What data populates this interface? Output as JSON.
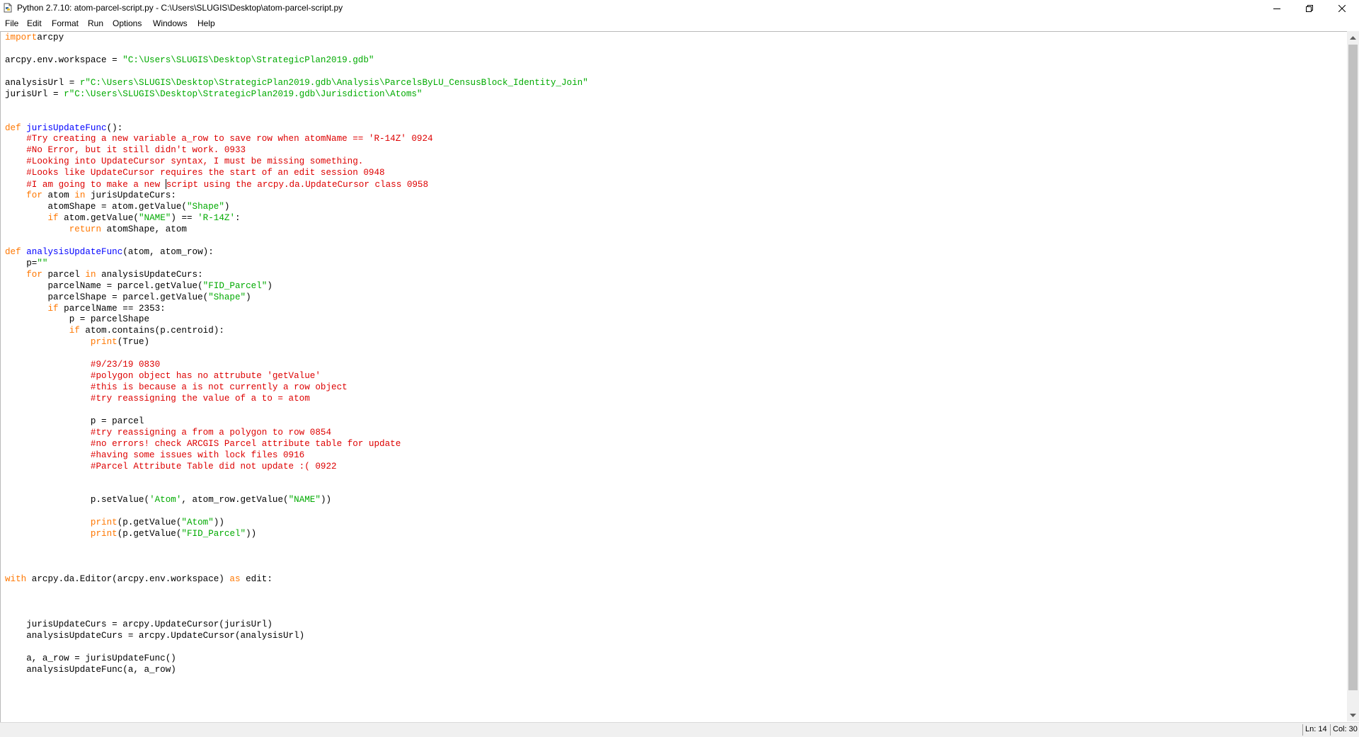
{
  "window": {
    "title": "Python 2.7.10: atom-parcel-script.py - C:\\Users\\SLUGIS\\Desktop\\atom-parcel-script.py"
  },
  "menu": [
    "File",
    "Edit",
    "Format",
    "Run",
    "Options",
    "Windows",
    "Help"
  ],
  "status": {
    "line": "Ln: 14",
    "col": "Col: 30"
  },
  "colors": {
    "keyword": "#ff7700",
    "builtin_def": "#0000ff",
    "string": "#00aa00",
    "comment": "#dd0000"
  },
  "code": [
    [
      [
        "kw",
        "import"
      ],
      [
        "",
        "arcpy"
      ]
    ],
    [],
    [
      [
        "",
        "arcpy.env.workspace = "
      ],
      [
        "str",
        "\"C:\\Users\\SLUGIS\\Desktop\\StrategicPlan2019.gdb\""
      ]
    ],
    [],
    [
      [
        "",
        "analysisUrl = "
      ],
      [
        "str",
        "r\"C:\\Users\\SLUGIS\\Desktop\\StrategicPlan2019.gdb\\Analysis\\ParcelsByLU_CensusBlock_Identity_Join\""
      ]
    ],
    [
      [
        "",
        "jurisUrl = "
      ],
      [
        "str",
        "r\"C:\\Users\\SLUGIS\\Desktop\\StrategicPlan2019.gdb\\Jurisdiction\\Atoms\""
      ]
    ],
    [],
    [],
    [
      [
        "kw",
        "def "
      ],
      [
        "fn",
        "jurisUpdateFunc"
      ],
      [
        "",
        "():"
      ]
    ],
    [
      [
        "",
        "    "
      ],
      [
        "cm",
        "#Try creating a new variable a_row to save row when atomName == 'R-14Z' 0924"
      ]
    ],
    [
      [
        "",
        "    "
      ],
      [
        "cm",
        "#No Error, but it still didn't work. 0933"
      ]
    ],
    [
      [
        "",
        "    "
      ],
      [
        "cm",
        "#Looking into UpdateCursor syntax, I must be missing something."
      ]
    ],
    [
      [
        "",
        "    "
      ],
      [
        "cm",
        "#Looks like UpdateCursor requires the start of an edit session 0948"
      ]
    ],
    [
      [
        "",
        "    "
      ],
      [
        "cm",
        "#I am going to make a new "
      ],
      [
        "caret",
        ""
      ],
      [
        "cm",
        "script using the arcpy.da.UpdateCursor class 0958"
      ]
    ],
    [
      [
        "",
        "    "
      ],
      [
        "kw",
        "for"
      ],
      [
        "",
        " atom "
      ],
      [
        "kw",
        "in"
      ],
      [
        "",
        " jurisUpdateCurs:"
      ]
    ],
    [
      [
        "",
        "        atomShape = atom.getValue("
      ],
      [
        "str",
        "\"Shape\""
      ],
      [
        "",
        ")"
      ]
    ],
    [
      [
        "",
        "        "
      ],
      [
        "kw",
        "if"
      ],
      [
        "",
        " atom.getValue("
      ],
      [
        "str",
        "\"NAME\""
      ],
      [
        "",
        ") == "
      ],
      [
        "str",
        "'R-14Z'"
      ],
      [
        "",
        ":"
      ]
    ],
    [
      [
        "",
        "            "
      ],
      [
        "kw",
        "return"
      ],
      [
        "",
        " atomShape, atom"
      ]
    ],
    [],
    [
      [
        "kw",
        "def "
      ],
      [
        "fn",
        "analysisUpdateFunc"
      ],
      [
        "",
        "(atom, atom_row):"
      ]
    ],
    [
      [
        "",
        "    p="
      ],
      [
        "str",
        "\"\""
      ]
    ],
    [
      [
        "",
        "    "
      ],
      [
        "kw",
        "for"
      ],
      [
        "",
        " parcel "
      ],
      [
        "kw",
        "in"
      ],
      [
        "",
        " analysisUpdateCurs:"
      ]
    ],
    [
      [
        "",
        "        parcelName = parcel.getValue("
      ],
      [
        "str",
        "\"FID_Parcel\""
      ],
      [
        "",
        ")"
      ]
    ],
    [
      [
        "",
        "        parcelShape = parcel.getValue("
      ],
      [
        "str",
        "\"Shape\""
      ],
      [
        "",
        ")"
      ]
    ],
    [
      [
        "",
        "        "
      ],
      [
        "kw",
        "if"
      ],
      [
        "",
        " parcelName == 2353:"
      ]
    ],
    [
      [
        "",
        "            p = parcelShape"
      ]
    ],
    [
      [
        "",
        "            "
      ],
      [
        "kw",
        "if"
      ],
      [
        "",
        " atom.contains(p.centroid):"
      ]
    ],
    [
      [
        "",
        "                "
      ],
      [
        "kw",
        "print"
      ],
      [
        "",
        "(True)"
      ]
    ],
    [],
    [
      [
        "",
        "                "
      ],
      [
        "cm",
        "#9/23/19 0830"
      ]
    ],
    [
      [
        "",
        "                "
      ],
      [
        "cm",
        "#polygon object has no attrubute 'getValue'"
      ]
    ],
    [
      [
        "",
        "                "
      ],
      [
        "cm",
        "#this is because a is not currently a row object"
      ]
    ],
    [
      [
        "",
        "                "
      ],
      [
        "cm",
        "#try reassigning the value of a to = atom"
      ]
    ],
    [],
    [
      [
        "",
        "                p = parcel"
      ]
    ],
    [
      [
        "",
        "                "
      ],
      [
        "cm",
        "#try reassigning a from a polygon to row 0854"
      ]
    ],
    [
      [
        "",
        "                "
      ],
      [
        "cm",
        "#no errors! check ARCGIS Parcel attribute table for update"
      ]
    ],
    [
      [
        "",
        "                "
      ],
      [
        "cm",
        "#having some issues with lock files 0916"
      ]
    ],
    [
      [
        "",
        "                "
      ],
      [
        "cm",
        "#Parcel Attribute Table did not update :( 0922"
      ]
    ],
    [],
    [],
    [
      [
        "",
        "                p.setValue("
      ],
      [
        "str",
        "'Atom'"
      ],
      [
        "",
        ", atom_row.getValue("
      ],
      [
        "str",
        "\"NAME\""
      ],
      [
        "",
        "))"
      ]
    ],
    [],
    [
      [
        "",
        "                "
      ],
      [
        "kw",
        "print"
      ],
      [
        "",
        "(p.getValue("
      ],
      [
        "str",
        "\"Atom\""
      ],
      [
        "",
        "))"
      ]
    ],
    [
      [
        "",
        "                "
      ],
      [
        "kw",
        "print"
      ],
      [
        "",
        "(p.getValue("
      ],
      [
        "str",
        "\"FID_Parcel\""
      ],
      [
        "",
        "))"
      ]
    ],
    [],
    [],
    [],
    [
      [
        "kw",
        "with"
      ],
      [
        "",
        " arcpy.da.Editor(arcpy.env.workspace) "
      ],
      [
        "kw",
        "as"
      ],
      [
        "",
        " edit:"
      ]
    ],
    [],
    [],
    [],
    [
      [
        "",
        "    jurisUpdateCurs = arcpy.UpdateCursor(jurisUrl)"
      ]
    ],
    [
      [
        "",
        "    analysisUpdateCurs = arcpy.UpdateCursor(analysisUrl)"
      ]
    ],
    [],
    [
      [
        "",
        "    a, a_row = jurisUpdateFunc()"
      ]
    ],
    [
      [
        "",
        "    analysisUpdateFunc(a, a_row)"
      ]
    ]
  ]
}
